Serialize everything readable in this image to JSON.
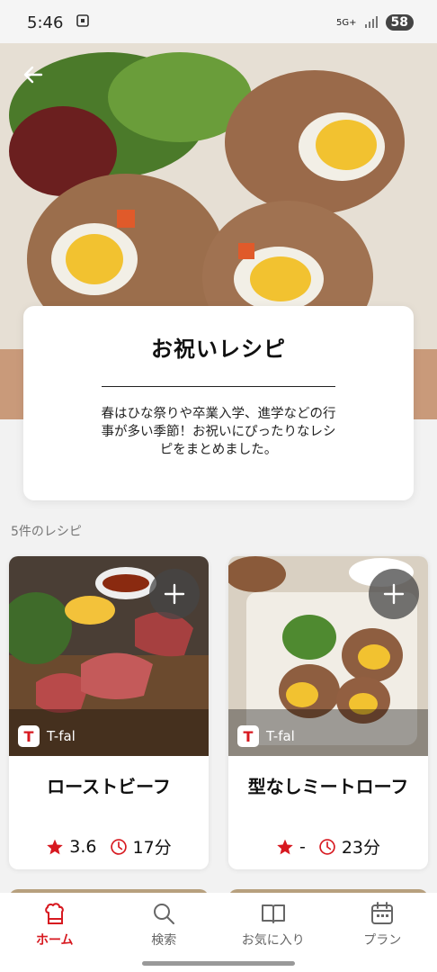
{
  "status": {
    "time": "5:46",
    "network": "5G+",
    "battery": "58"
  },
  "collection": {
    "title": "お祝いレシピ",
    "description": "春はひな祭りや卒業入学、進学などの行事が多い季節！お祝いにぴったりなレシピをまとめました。",
    "count_label": "5件のレシピ"
  },
  "recipes": [
    {
      "name": "ローストビーフ",
      "brand": "T-fal",
      "rating": "3.6",
      "time": "17分"
    },
    {
      "name": "型なしミートローフ",
      "brand": "T-fal",
      "rating": "-",
      "time": "23分"
    }
  ],
  "nav": {
    "items": [
      {
        "label": "ホーム",
        "icon": "home-icon",
        "active": true
      },
      {
        "label": "検索",
        "icon": "search-icon",
        "active": false
      },
      {
        "label": "お気に入り",
        "icon": "book-icon",
        "active": false
      },
      {
        "label": "プラン",
        "icon": "calendar-icon",
        "active": false
      }
    ]
  },
  "colors": {
    "accent": "#d71920",
    "background": "#f2f2f2"
  }
}
